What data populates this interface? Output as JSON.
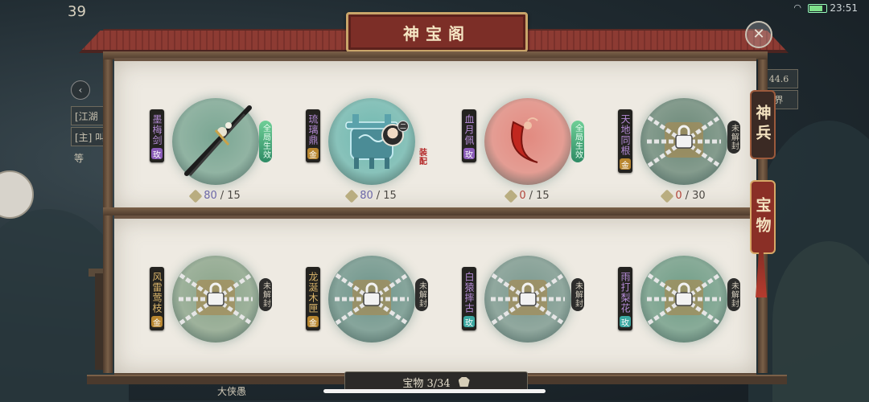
{
  "status": {
    "time": "23:51",
    "level": "39"
  },
  "title": "神宝阁",
  "left_hud": {
    "tag1": "[江湖",
    "tag2": "[主] 叫",
    "tag3": "等"
  },
  "right_hud": {
    "chip1": "44.6",
    "chip2": "界"
  },
  "tabs": [
    {
      "label": "神兵",
      "active": false
    },
    {
      "label": "宝物",
      "active": true
    }
  ],
  "items": [
    {
      "name": "墨梅剑",
      "grade": "玫",
      "grade_color": "purple",
      "name_color": "purple",
      "side": "全局生效",
      "side_type": "effect",
      "progress_current": "80",
      "progress_total": "15",
      "locked": false,
      "icon": "sword-icon",
      "bg": "#7aa693"
    },
    {
      "name": "琉璃鼎",
      "grade": "金",
      "grade_color": "gold",
      "name_color": "purple",
      "side": "装配",
      "side_type": "equipped",
      "progress_current": "80",
      "progress_total": "15",
      "locked": false,
      "icon": "cauldron-icon",
      "bg": "#6fb8b0",
      "avatar_badge": "二"
    },
    {
      "name": "血月佩",
      "grade": "玫",
      "grade_color": "purple",
      "name_color": "purple",
      "side": "全局生效",
      "side_type": "effect",
      "progress_current": "0",
      "progress_total": "15",
      "locked": false,
      "icon": "crescent-pendant-icon",
      "bg": "#e28a80"
    },
    {
      "name": "天地同根",
      "grade": "金",
      "grade_color": "gold",
      "name_color": "purple",
      "side": "未解封",
      "side_type": "sealed",
      "progress_current": "0",
      "progress_total": "30",
      "locked": true,
      "icon": "chained-treasure-icon",
      "bg": "#6a8878"
    },
    {
      "name": "风雷莺枝",
      "grade": "金",
      "grade_color": "gold",
      "name_color": "gold",
      "side": "未解封",
      "side_type": "sealed",
      "locked": true,
      "icon": "chained-treasure-icon",
      "bg": "#8aa48a"
    },
    {
      "name": "龙涎木匣",
      "grade": "金",
      "grade_color": "gold",
      "name_color": "gold",
      "side": "未解封",
      "side_type": "sealed",
      "locked": true,
      "icon": "chained-treasure-icon",
      "bg": "#6d948a"
    },
    {
      "name": "白猿摔古",
      "grade": "玫",
      "grade_color": "cyan",
      "name_color": "purple",
      "side": "未解封",
      "side_type": "sealed",
      "locked": true,
      "icon": "chained-treasure-icon",
      "bg": "#7a988e"
    },
    {
      "name": "雨打梨花",
      "grade": "玫",
      "grade_color": "cyan",
      "name_color": "purple",
      "side": "未解封",
      "side_type": "sealed",
      "locked": true,
      "icon": "chained-treasure-icon",
      "bg": "#6f9c86"
    }
  ],
  "footer": {
    "counter_label": "宝物 3/34",
    "player_name": "大侠愚"
  }
}
